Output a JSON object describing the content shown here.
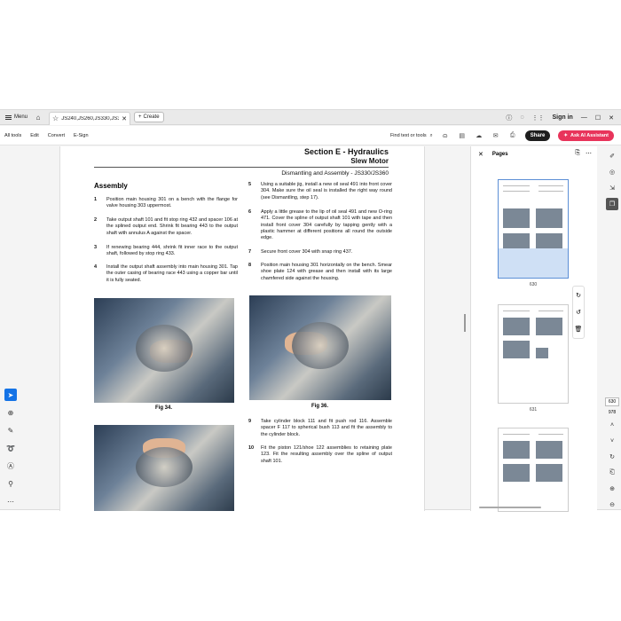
{
  "tabbar": {
    "menu_label": "Menu",
    "tab_title": "JS240,JS260,JS330,JS36..",
    "create_label": "Create",
    "sign_in": "Sign in"
  },
  "toolbar": {
    "all_tools": "All tools",
    "edit": "Edit",
    "convert": "Convert",
    "esign": "E-Sign",
    "find": "Find text or tools",
    "share": "Share",
    "ai_assistant": "Ask AI Assistant"
  },
  "document": {
    "section_title": "Section E - Hydraulics",
    "section_subtitle": "Slew Motor",
    "section_sub2": "Dismantling and Assembly - JS330/JS360",
    "heading": "Assembly",
    "left_steps": [
      {
        "n": "1",
        "text": "Position main housing 301 on a bench with the flange for valve housing 303 uppermost."
      },
      {
        "n": "2",
        "text": "Take output shaft 101 and fit stop ring 432 and spacer 106 at the splined output end. Shrink fit bearing 443 to the output shaft with annulus A against the spacer."
      },
      {
        "n": "3",
        "text": "If renewing bearing 444, shrink fit inner race to the output shaft, followed by stop ring 433."
      },
      {
        "n": "4",
        "text": "Install the output shaft assembly into main housing 301. Tap the outer casing of bearing race 443 using a copper bar until it is fully seated."
      }
    ],
    "right_steps": [
      {
        "n": "5",
        "text": "Using a suitable jig, install a new oil seal 491 into front cover 304. Make sure the oil seal is installed the right way round (see Dismantling, step 17)."
      },
      {
        "n": "6",
        "text": "Apply a little grease to the lip of oil seal 491 and new O-ring 471. Cover the spline of output shaft 101 with tape and then install front cover 304 carefully by tapping gently with a plastic hammer at different positions all round the outside edge."
      },
      {
        "n": "7",
        "text": "Secure front cover 304 with snap ring 437."
      },
      {
        "n": "8",
        "text": "Position main housing 301 horizontally on the bench. Smear shoe plate 124 with grease and then install with its large chamfered side against the housing."
      }
    ],
    "lower_steps": [
      {
        "n": "9",
        "text": "Take cylinder block 111 and fit push rod 116. Assemble spacer F 117 to spherical bush 113 and fit the assembly to the cylinder block."
      },
      {
        "n": "10",
        "text": "Fit the piston 121/shoe 122 assemblies to retaining plate 123. Fit the resulting assembly over the spline of output shaft 101."
      }
    ],
    "fig34": "Fig 34.",
    "fig36": "Fig 36."
  },
  "pages_panel": {
    "title": "Pages",
    "thumbs": [
      {
        "label": "630"
      },
      {
        "label": "631"
      },
      {
        "label": ""
      }
    ]
  },
  "rail": {
    "current_page": "630",
    "total_pages": "978"
  },
  "colors": {
    "accent": "#1473e6",
    "ai_button": "#e8345b",
    "share_button": "#1e1e1e"
  }
}
